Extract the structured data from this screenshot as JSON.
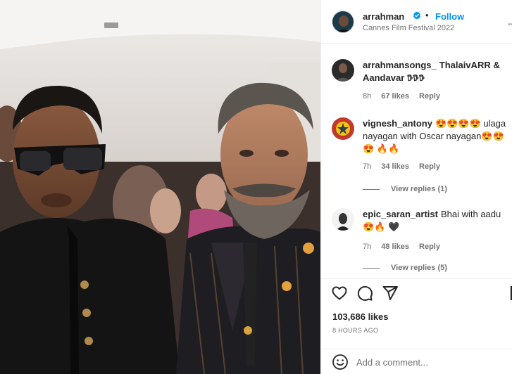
{
  "post": {
    "username": "arrahman",
    "follow_label": "Follow",
    "location": "Cannes Film Festival 2022",
    "dot": "•",
    "more": "...",
    "verified_icon": "verified-badge-icon",
    "accent_color": "#0095f6"
  },
  "comments": [
    {
      "username": "arrahmansongs_",
      "text": "ThalaivARR & Aandavar 𖠚𖠚𖠚",
      "time": "8h",
      "likes": "67 likes",
      "reply": "Reply"
    },
    {
      "username": "vignesh_antony",
      "text": "😍😍😍😍 ulaga nayagan with Oscar nayagan😍😍😍 🔥🔥",
      "time": "7h",
      "likes": "34 likes",
      "reply": "Reply",
      "view_replies": "View replies (1)"
    },
    {
      "username": "epic_saran_artist",
      "text": "Bhai with aadu😍🔥 🖤",
      "time": "7h",
      "likes": "48 likes",
      "reply": "Reply",
      "view_replies": "View replies (5)"
    }
  ],
  "actions": {
    "like_icon": "heart-icon",
    "comment_icon": "comment-icon",
    "share_icon": "share-icon",
    "save_icon": "bookmark-icon"
  },
  "likes_count": "103,686 likes",
  "posted_time": "8 HOURS AGO",
  "add_comment": {
    "placeholder": "Add a comment...",
    "emoji_icon": "emoji-icon"
  }
}
